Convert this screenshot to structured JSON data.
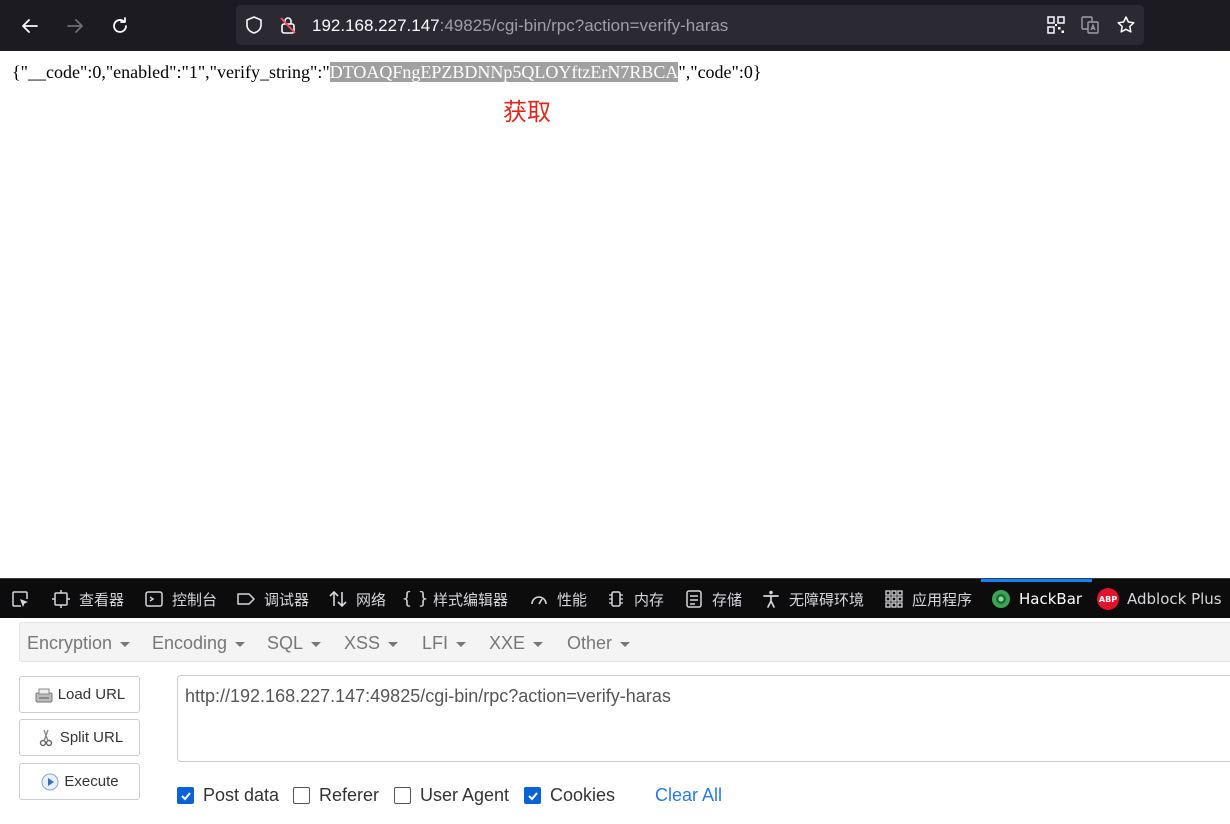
{
  "browser": {
    "url_host": "192.168.227.147",
    "url_rest": ":49825/cgi-bin/rpc?action=verify-haras"
  },
  "page": {
    "json_prefix": "{\"__code\":0,\"enabled\":\"1\",\"verify_string\":\"",
    "json_highlight": "DTOAQFngEPZBDNNp5QLOYftzErN7RBCA",
    "json_suffix": "\",\"code\":0}",
    "annotation": "获取",
    "annotation_color": "#e0251b"
  },
  "devtools": {
    "tabs": [
      {
        "label": "查看器",
        "icon": "inspector-icon"
      },
      {
        "label": "控制台",
        "icon": "console-icon"
      },
      {
        "label": "调试器",
        "icon": "debugger-icon"
      },
      {
        "label": "网络",
        "icon": "network-icon"
      },
      {
        "label": "样式编辑器",
        "icon": "style-editor-icon"
      },
      {
        "label": "性能",
        "icon": "performance-icon"
      },
      {
        "label": "内存",
        "icon": "memory-icon"
      },
      {
        "label": "存储",
        "icon": "storage-icon"
      },
      {
        "label": "无障碍环境",
        "icon": "accessibility-icon"
      },
      {
        "label": "应用程序",
        "icon": "application-icon"
      },
      {
        "label": "HackBar",
        "icon": "hackbar-icon"
      },
      {
        "label": "Adblock Plus",
        "icon": "abp-icon"
      }
    ],
    "active_tab": "HackBar",
    "abp_badge": "ABP"
  },
  "hackbar": {
    "menu": [
      "Encryption",
      "Encoding",
      "SQL",
      "XSS",
      "LFI",
      "XXE",
      "Other"
    ],
    "buttons": {
      "load_url": "Load URL",
      "split_url": "Split URL",
      "execute": "Execute"
    },
    "url_value": "http://192.168.227.147:49825/cgi-bin/rpc?action=verify-haras",
    "checks": [
      {
        "label": "Post data",
        "checked": true
      },
      {
        "label": "Referer",
        "checked": false
      },
      {
        "label": "User Agent",
        "checked": false
      },
      {
        "label": "Cookies",
        "checked": true
      }
    ],
    "clear_all": "Clear All",
    "accent": "#0b62d6"
  }
}
